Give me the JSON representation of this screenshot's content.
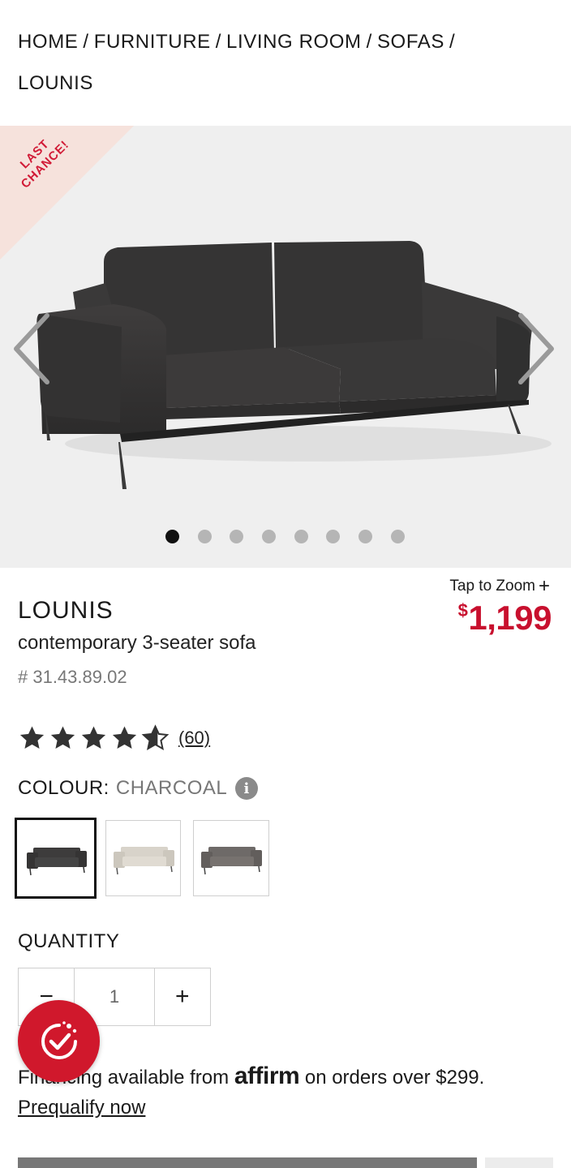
{
  "breadcrumb": {
    "items": [
      "HOME",
      "FURNITURE",
      "LIVING ROOM",
      "SOFAS",
      "LOUNIS"
    ],
    "separator": "/"
  },
  "gallery": {
    "badge_line1": "LAST",
    "badge_line2": "CHANCE!",
    "badge_color": "#d11a36",
    "slide_count": 8,
    "active_slide": 0,
    "prev_icon": "chevron-left-icon",
    "next_icon": "chevron-right-icon"
  },
  "zoom": {
    "label": "Tap to Zoom",
    "icon": "+"
  },
  "product": {
    "name": "LOUNIS",
    "subtitle": "contemporary 3-seater sofa",
    "sku": "# 31.43.89.02",
    "price_currency": "$",
    "price_amount": "1,199",
    "price_color": "#c8102e"
  },
  "rating": {
    "stars": 4.5,
    "max": 5,
    "reviews": "(60)"
  },
  "colour": {
    "label": "COLOUR:",
    "value": "CHARCOAL",
    "info_icon": "i",
    "swatches": [
      {
        "name": "charcoal",
        "color": "#3d3c3c",
        "selected": true
      },
      {
        "name": "beige",
        "color": "#d8d3ca",
        "selected": false
      },
      {
        "name": "grey",
        "color": "#6e6a68",
        "selected": false
      }
    ]
  },
  "quantity": {
    "label": "QUANTITY",
    "value": "1",
    "minus": "−",
    "plus": "+"
  },
  "financing": {
    "prefix": "Financing available from",
    "brand": "affirm",
    "suffix": "on orders over $299.",
    "link": "Prequalify now"
  },
  "fab": {
    "icon": "check-badge-icon",
    "color": "#d0182c"
  }
}
